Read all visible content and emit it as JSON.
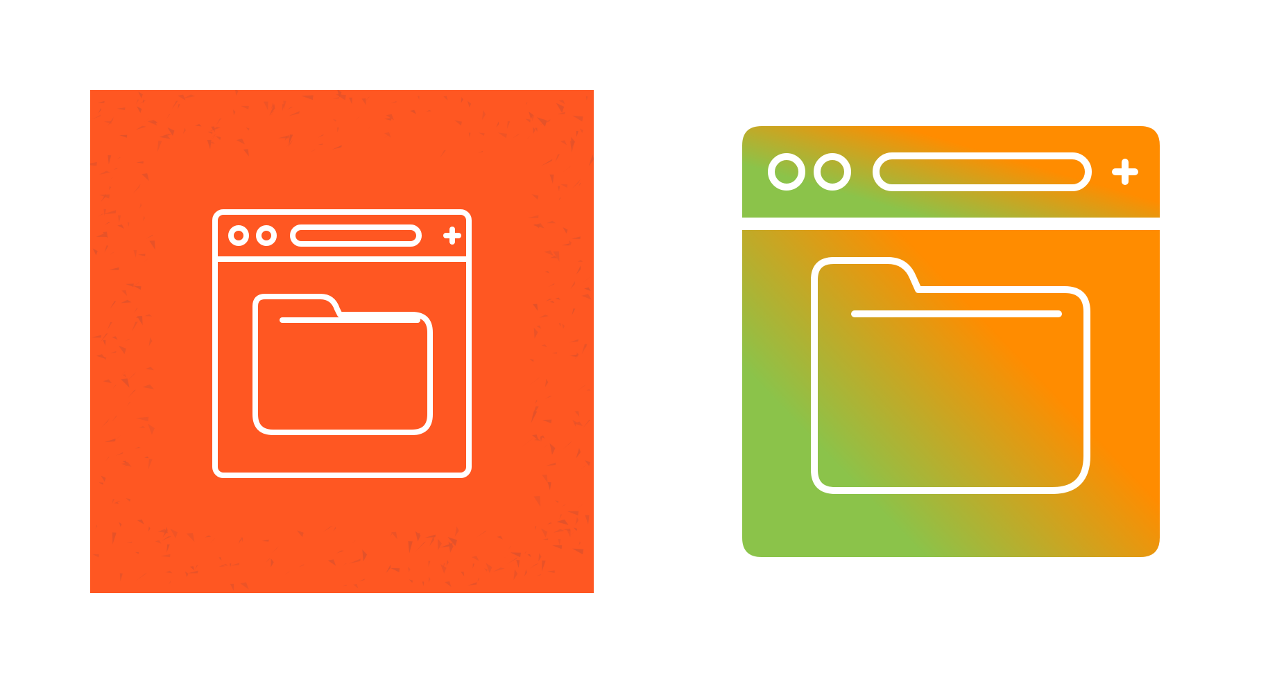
{
  "left_icon": {
    "name": "browser-folder-icon-line-style",
    "background_color": "#ff5722",
    "texture_color": "#e3522a",
    "line_color": "#ffffff"
  },
  "right_icon": {
    "name": "browser-folder-icon-gradient-style",
    "gradient_colors": [
      "#8bc34a",
      "#ff8c00"
    ],
    "line_color": "#ffffff"
  }
}
